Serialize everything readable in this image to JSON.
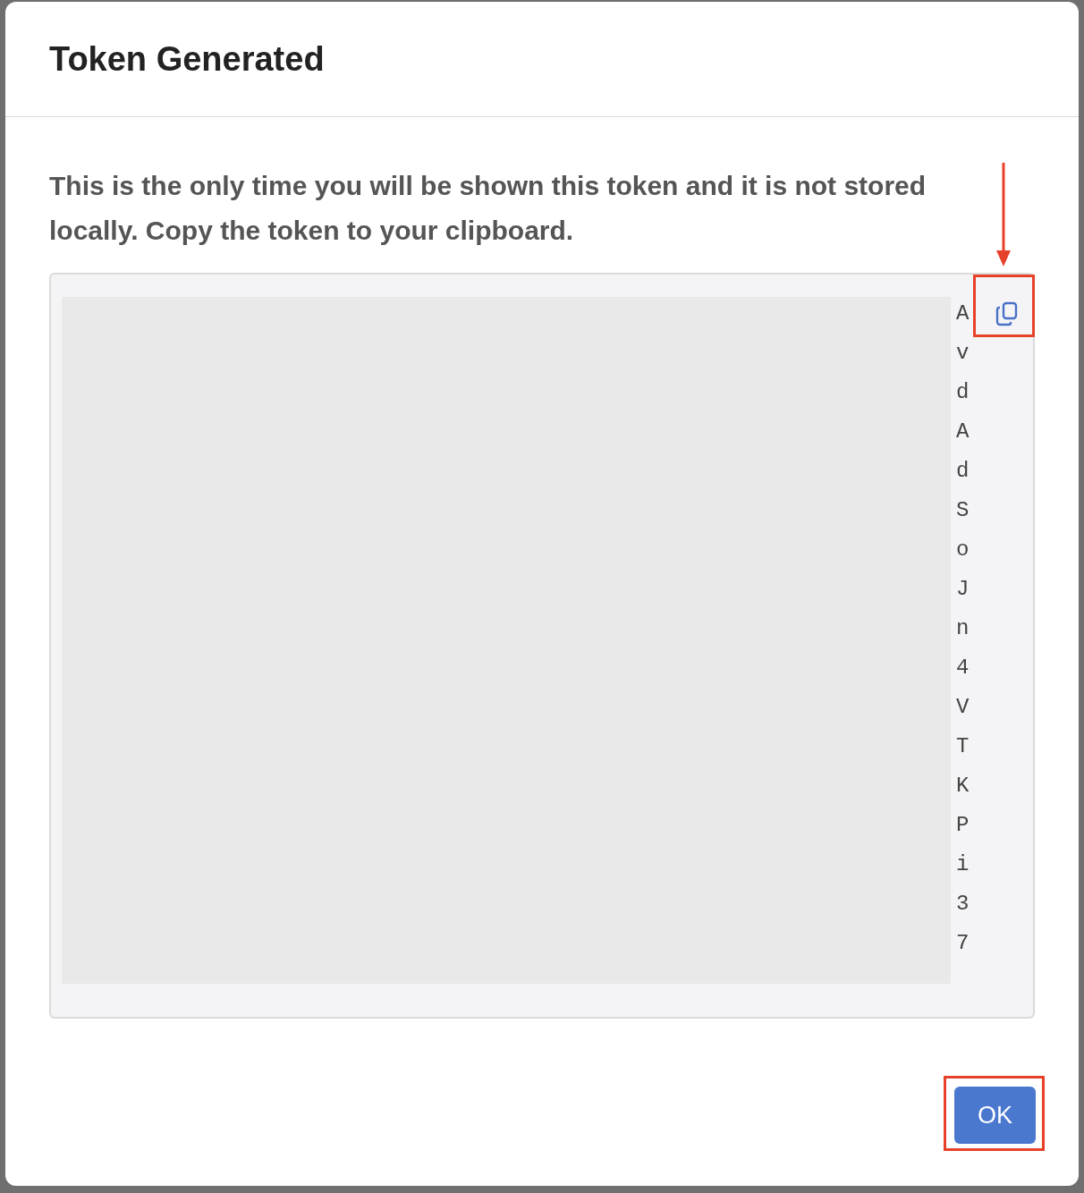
{
  "dialog": {
    "title": "Token Generated",
    "message": "This is the only time you will be shown this token and it is not stored locally. Copy the token to your clipboard.",
    "token": {
      "redacted": true,
      "visible_characters": [
        "A",
        "v",
        "d",
        "A",
        "d",
        "S",
        "o",
        "J",
        "n",
        "4",
        "V",
        "T",
        "K",
        "P",
        "i",
        "3",
        "7"
      ]
    },
    "ok_button": {
      "label": "OK"
    }
  },
  "annotations": [
    {
      "kind": "arrow-box"
    },
    {
      "kind": "box"
    }
  ]
}
